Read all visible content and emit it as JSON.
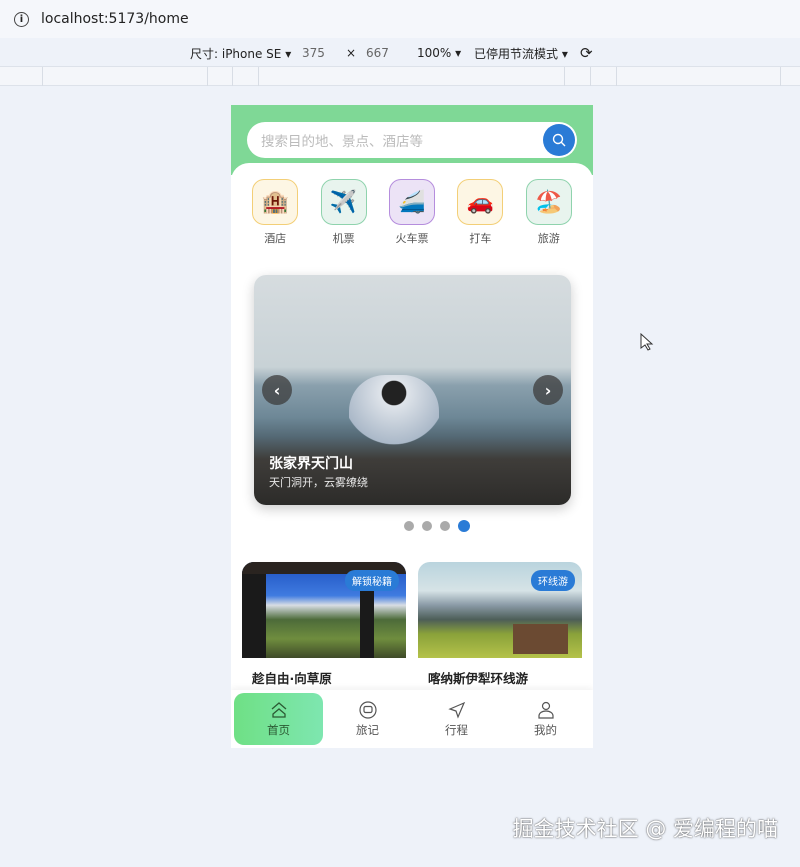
{
  "browser": {
    "url": "localhost:5173/home"
  },
  "devtools": {
    "size_label": "尺寸: iPhone SE ▾",
    "width": "375",
    "x": "×",
    "height": "667",
    "zoom": "100% ▾",
    "throttle": "已停用节流模式 ▾"
  },
  "search": {
    "placeholder": "搜索目的地、景点、酒店等"
  },
  "categories": [
    {
      "label": "酒店",
      "icon": "🏨",
      "bg": "#fdf6e4",
      "border": "#f3cf77"
    },
    {
      "label": "机票",
      "icon": "✈️",
      "bg": "#e8f4ee",
      "border": "#8fd3ad"
    },
    {
      "label": "火车票",
      "icon": "🚄",
      "bg": "#ece3f6",
      "border": "#b58ddd"
    },
    {
      "label": "打车",
      "icon": "🚗",
      "bg": "#fdf6e4",
      "border": "#f3cf77"
    },
    {
      "label": "旅游",
      "icon": "🏖️",
      "bg": "#e8f4ee",
      "border": "#8fd3ad"
    }
  ],
  "carousel": {
    "title": "张家界天门山",
    "subtitle": "天门洞开，云雾缭绕",
    "prev": "‹",
    "next": "›",
    "active_index": 3,
    "count": 4
  },
  "cards": [
    {
      "name": "趁自由·向草原",
      "tag": "解锁秘籍"
    },
    {
      "name": "喀纳斯伊犁环线游",
      "tag": "环线游"
    }
  ],
  "nav": [
    {
      "label": "首页",
      "active": true
    },
    {
      "label": "旅记"
    },
    {
      "label": "行程"
    },
    {
      "label": "我的"
    }
  ],
  "watermark": "掘金技术社区 @ 爱编程的喵"
}
